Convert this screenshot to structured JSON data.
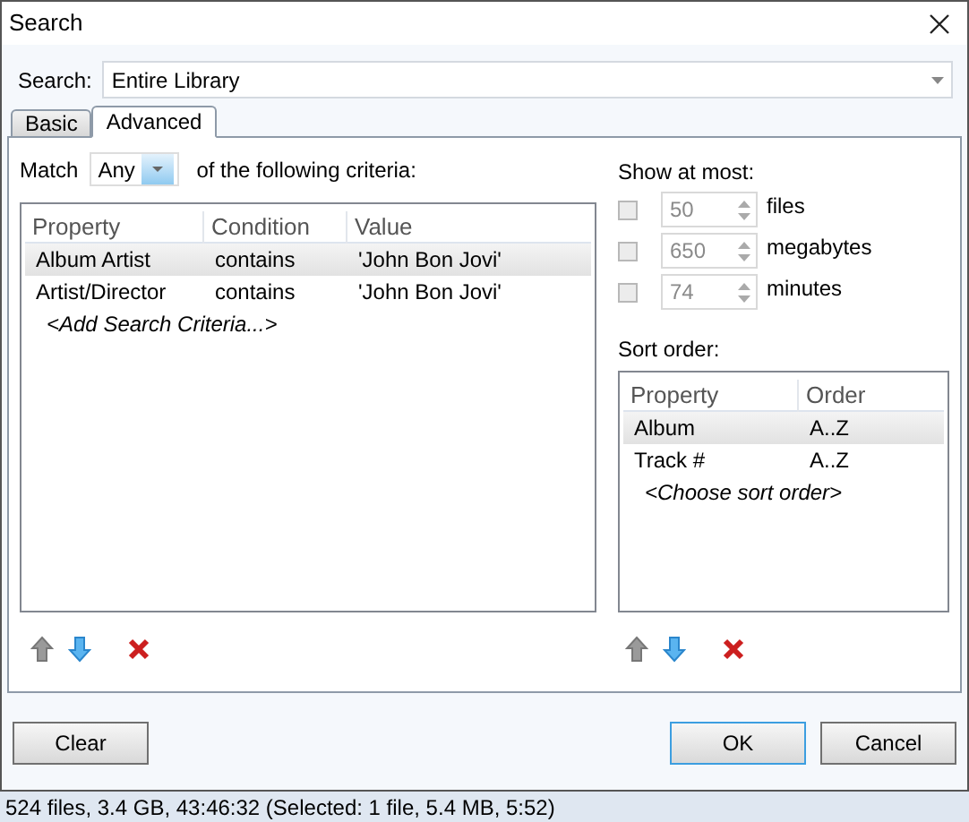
{
  "window": {
    "title": "Search"
  },
  "search": {
    "label": "Search:",
    "value": "Entire Library"
  },
  "tabs": [
    {
      "label": "Basic",
      "selected": false
    },
    {
      "label": "Advanced",
      "selected": true
    }
  ],
  "match": {
    "prefix": "Match",
    "value": "Any",
    "suffix": "of the following criteria:"
  },
  "criteria": {
    "columns": [
      "Property",
      "Condition",
      "Value"
    ],
    "rows": [
      {
        "cells": [
          "Album Artist",
          "contains",
          "'John Bon Jovi'"
        ],
        "selected": true
      },
      {
        "cells": [
          "Artist/Director",
          "contains",
          "'John Bon Jovi'"
        ],
        "selected": false
      }
    ],
    "hint": "<Add Search Criteria...>"
  },
  "limits": {
    "title": "Show at most:",
    "items": [
      {
        "checked": false,
        "value": "50",
        "unit": "files"
      },
      {
        "checked": false,
        "value": "650",
        "unit": "megabytes"
      },
      {
        "checked": false,
        "value": "74",
        "unit": "minutes"
      }
    ]
  },
  "sort": {
    "title": "Sort order:",
    "columns": [
      "Property",
      "Order"
    ],
    "rows": [
      {
        "cells": [
          "Album",
          "A..Z"
        ],
        "selected": true
      },
      {
        "cells": [
          "Track #",
          "A..Z"
        ],
        "selected": false
      }
    ],
    "hint": "<Choose sort order>"
  },
  "buttons": [
    {
      "label": "Clear",
      "default": false
    },
    {
      "label": "OK",
      "default": true
    },
    {
      "label": "Cancel",
      "default": false
    }
  ],
  "status_bar": "524 files, 3.4 GB, 43:46:32 (Selected: 1 file, 5.4 MB, 5:52)"
}
